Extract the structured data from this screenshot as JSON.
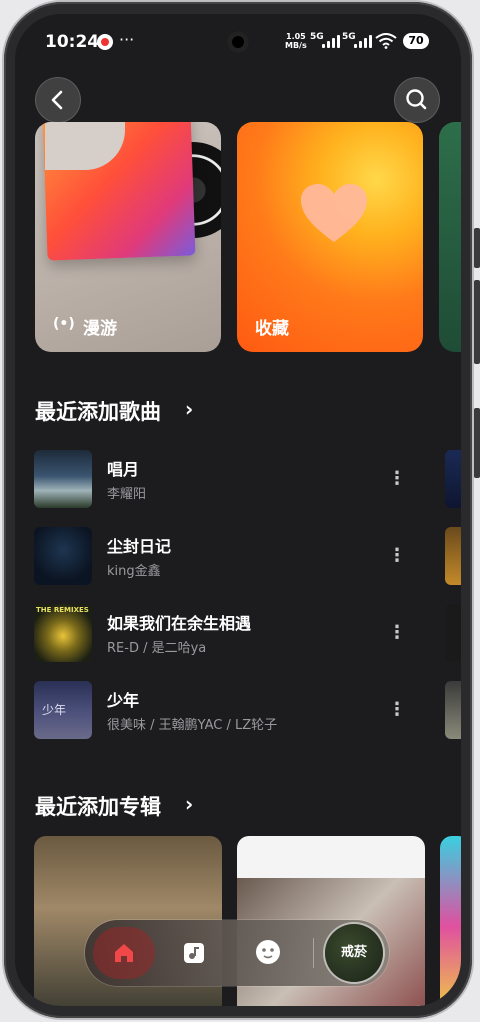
{
  "status_bar": {
    "time": "10:24",
    "net_speed_value": "1.05",
    "net_speed_unit": "MB/s",
    "sig1": "5G",
    "sig2": "5G",
    "battery": "70"
  },
  "hero_cards": [
    {
      "label": "漫游",
      "icon": "radio-waves-icon"
    },
    {
      "label": "收藏",
      "icon": "heart-icon"
    }
  ],
  "recent_songs": {
    "title": "最近添加歌曲",
    "items": [
      {
        "title": "唱月",
        "artist": "李耀阳"
      },
      {
        "title": "尘封日记",
        "artist": "king金鑫"
      },
      {
        "title": "如果我们在余生相遇",
        "artist": "RE-D / 是二哈ya",
        "cover_text": "THE REMIXES"
      },
      {
        "title": "少年",
        "artist": "很美味 / 王翰鹏YAC / LZ轮子",
        "cover_text": "少年"
      }
    ]
  },
  "recent_albums": {
    "title": "最近添加专辑"
  },
  "now_playing": {
    "cover_text": "戒菸"
  },
  "colors": {
    "accent": "#ff5a12",
    "background": "#1c1c1e",
    "nav_home": "#e03a3a"
  }
}
